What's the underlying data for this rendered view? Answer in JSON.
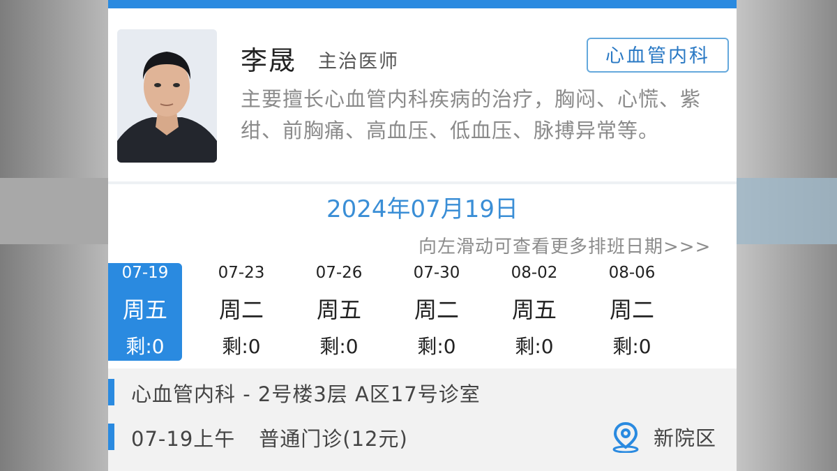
{
  "doctor": {
    "name": "李晟",
    "title": "主治医师",
    "department_tag": "心血管内科",
    "description": "主要擅长心血管内科疾病的治疗，胸闷、心慌、紫绀、前胸痛、高血压、低血压、脉搏异常等。"
  },
  "schedule": {
    "selected_date": "2024年07月19日",
    "swipe_hint": "向左滑动可查看更多排班日期>>>",
    "days": [
      {
        "date": "07-19",
        "weekday": "周五",
        "remaining": "剩:0",
        "selected": true
      },
      {
        "date": "07-23",
        "weekday": "周二",
        "remaining": "剩:0",
        "selected": false
      },
      {
        "date": "07-26",
        "weekday": "周五",
        "remaining": "剩:0",
        "selected": false
      },
      {
        "date": "07-30",
        "weekday": "周二",
        "remaining": "剩:0",
        "selected": false
      },
      {
        "date": "08-02",
        "weekday": "周五",
        "remaining": "剩:0",
        "selected": false
      },
      {
        "date": "08-06",
        "weekday": "周二",
        "remaining": "剩:0",
        "selected": false
      }
    ]
  },
  "clinic": {
    "location": "心血管内科 - 2号楼3层 A区17号诊室",
    "session": "07-19上午",
    "visit_type": "普通门诊(12元)",
    "campus": "新院区",
    "campus_icon": "location-pin-icon"
  },
  "colors": {
    "accent": "#2a8ae0",
    "tag_border": "#64a8dc",
    "date_text": "#3a8ed6"
  }
}
